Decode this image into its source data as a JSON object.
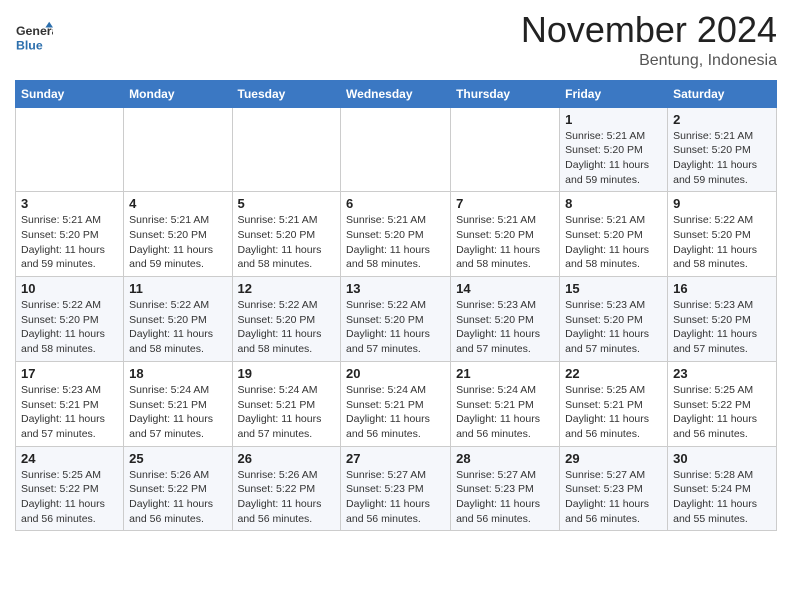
{
  "header": {
    "logo_general": "General",
    "logo_blue": "Blue",
    "month_title": "November 2024",
    "location": "Bentung, Indonesia"
  },
  "days_of_week": [
    "Sunday",
    "Monday",
    "Tuesday",
    "Wednesday",
    "Thursday",
    "Friday",
    "Saturday"
  ],
  "weeks": [
    [
      {
        "day": "",
        "sunrise": "",
        "sunset": "",
        "daylight": ""
      },
      {
        "day": "",
        "sunrise": "",
        "sunset": "",
        "daylight": ""
      },
      {
        "day": "",
        "sunrise": "",
        "sunset": "",
        "daylight": ""
      },
      {
        "day": "",
        "sunrise": "",
        "sunset": "",
        "daylight": ""
      },
      {
        "day": "",
        "sunrise": "",
        "sunset": "",
        "daylight": ""
      },
      {
        "day": "1",
        "sunrise": "Sunrise: 5:21 AM",
        "sunset": "Sunset: 5:20 PM",
        "daylight": "Daylight: 11 hours and 59 minutes."
      },
      {
        "day": "2",
        "sunrise": "Sunrise: 5:21 AM",
        "sunset": "Sunset: 5:20 PM",
        "daylight": "Daylight: 11 hours and 59 minutes."
      }
    ],
    [
      {
        "day": "3",
        "sunrise": "Sunrise: 5:21 AM",
        "sunset": "Sunset: 5:20 PM",
        "daylight": "Daylight: 11 hours and 59 minutes."
      },
      {
        "day": "4",
        "sunrise": "Sunrise: 5:21 AM",
        "sunset": "Sunset: 5:20 PM",
        "daylight": "Daylight: 11 hours and 59 minutes."
      },
      {
        "day": "5",
        "sunrise": "Sunrise: 5:21 AM",
        "sunset": "Sunset: 5:20 PM",
        "daylight": "Daylight: 11 hours and 58 minutes."
      },
      {
        "day": "6",
        "sunrise": "Sunrise: 5:21 AM",
        "sunset": "Sunset: 5:20 PM",
        "daylight": "Daylight: 11 hours and 58 minutes."
      },
      {
        "day": "7",
        "sunrise": "Sunrise: 5:21 AM",
        "sunset": "Sunset: 5:20 PM",
        "daylight": "Daylight: 11 hours and 58 minutes."
      },
      {
        "day": "8",
        "sunrise": "Sunrise: 5:21 AM",
        "sunset": "Sunset: 5:20 PM",
        "daylight": "Daylight: 11 hours and 58 minutes."
      },
      {
        "day": "9",
        "sunrise": "Sunrise: 5:22 AM",
        "sunset": "Sunset: 5:20 PM",
        "daylight": "Daylight: 11 hours and 58 minutes."
      }
    ],
    [
      {
        "day": "10",
        "sunrise": "Sunrise: 5:22 AM",
        "sunset": "Sunset: 5:20 PM",
        "daylight": "Daylight: 11 hours and 58 minutes."
      },
      {
        "day": "11",
        "sunrise": "Sunrise: 5:22 AM",
        "sunset": "Sunset: 5:20 PM",
        "daylight": "Daylight: 11 hours and 58 minutes."
      },
      {
        "day": "12",
        "sunrise": "Sunrise: 5:22 AM",
        "sunset": "Sunset: 5:20 PM",
        "daylight": "Daylight: 11 hours and 58 minutes."
      },
      {
        "day": "13",
        "sunrise": "Sunrise: 5:22 AM",
        "sunset": "Sunset: 5:20 PM",
        "daylight": "Daylight: 11 hours and 57 minutes."
      },
      {
        "day": "14",
        "sunrise": "Sunrise: 5:23 AM",
        "sunset": "Sunset: 5:20 PM",
        "daylight": "Daylight: 11 hours and 57 minutes."
      },
      {
        "day": "15",
        "sunrise": "Sunrise: 5:23 AM",
        "sunset": "Sunset: 5:20 PM",
        "daylight": "Daylight: 11 hours and 57 minutes."
      },
      {
        "day": "16",
        "sunrise": "Sunrise: 5:23 AM",
        "sunset": "Sunset: 5:20 PM",
        "daylight": "Daylight: 11 hours and 57 minutes."
      }
    ],
    [
      {
        "day": "17",
        "sunrise": "Sunrise: 5:23 AM",
        "sunset": "Sunset: 5:21 PM",
        "daylight": "Daylight: 11 hours and 57 minutes."
      },
      {
        "day": "18",
        "sunrise": "Sunrise: 5:24 AM",
        "sunset": "Sunset: 5:21 PM",
        "daylight": "Daylight: 11 hours and 57 minutes."
      },
      {
        "day": "19",
        "sunrise": "Sunrise: 5:24 AM",
        "sunset": "Sunset: 5:21 PM",
        "daylight": "Daylight: 11 hours and 57 minutes."
      },
      {
        "day": "20",
        "sunrise": "Sunrise: 5:24 AM",
        "sunset": "Sunset: 5:21 PM",
        "daylight": "Daylight: 11 hours and 56 minutes."
      },
      {
        "day": "21",
        "sunrise": "Sunrise: 5:24 AM",
        "sunset": "Sunset: 5:21 PM",
        "daylight": "Daylight: 11 hours and 56 minutes."
      },
      {
        "day": "22",
        "sunrise": "Sunrise: 5:25 AM",
        "sunset": "Sunset: 5:21 PM",
        "daylight": "Daylight: 11 hours and 56 minutes."
      },
      {
        "day": "23",
        "sunrise": "Sunrise: 5:25 AM",
        "sunset": "Sunset: 5:22 PM",
        "daylight": "Daylight: 11 hours and 56 minutes."
      }
    ],
    [
      {
        "day": "24",
        "sunrise": "Sunrise: 5:25 AM",
        "sunset": "Sunset: 5:22 PM",
        "daylight": "Daylight: 11 hours and 56 minutes."
      },
      {
        "day": "25",
        "sunrise": "Sunrise: 5:26 AM",
        "sunset": "Sunset: 5:22 PM",
        "daylight": "Daylight: 11 hours and 56 minutes."
      },
      {
        "day": "26",
        "sunrise": "Sunrise: 5:26 AM",
        "sunset": "Sunset: 5:22 PM",
        "daylight": "Daylight: 11 hours and 56 minutes."
      },
      {
        "day": "27",
        "sunrise": "Sunrise: 5:27 AM",
        "sunset": "Sunset: 5:23 PM",
        "daylight": "Daylight: 11 hours and 56 minutes."
      },
      {
        "day": "28",
        "sunrise": "Sunrise: 5:27 AM",
        "sunset": "Sunset: 5:23 PM",
        "daylight": "Daylight: 11 hours and 56 minutes."
      },
      {
        "day": "29",
        "sunrise": "Sunrise: 5:27 AM",
        "sunset": "Sunset: 5:23 PM",
        "daylight": "Daylight: 11 hours and 56 minutes."
      },
      {
        "day": "30",
        "sunrise": "Sunrise: 5:28 AM",
        "sunset": "Sunset: 5:24 PM",
        "daylight": "Daylight: 11 hours and 55 minutes."
      }
    ]
  ]
}
